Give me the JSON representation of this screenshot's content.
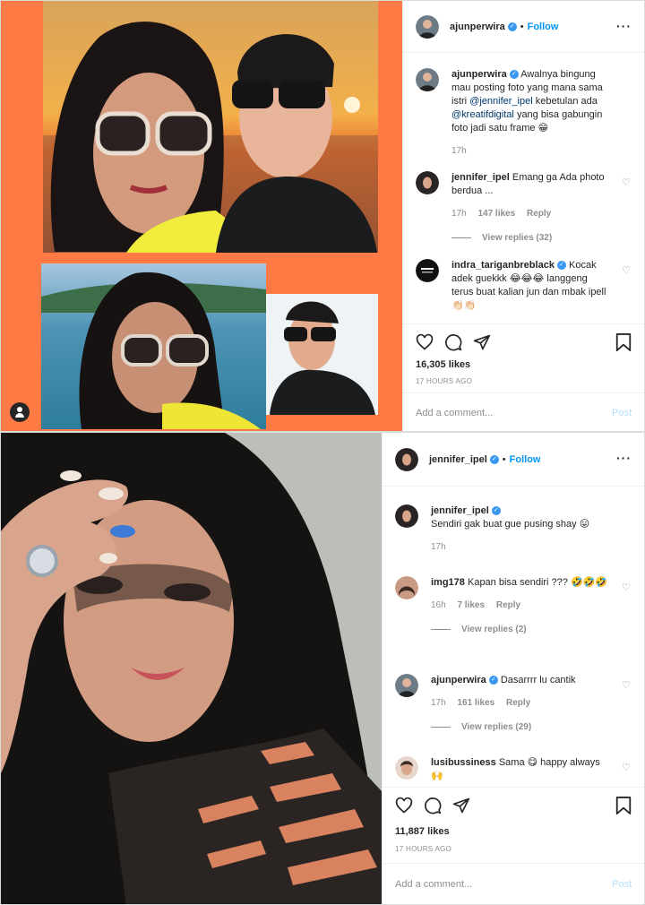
{
  "post1": {
    "header": {
      "username": "ajunperwira",
      "follow": "Follow",
      "separator": "•"
    },
    "caption": {
      "username": "ajunperwira",
      "text_1": "Awalnya bingung mau posting foto yang mana sama istri",
      "mention_1": "@jennifer_ipel",
      "text_2": "kebetulan ada",
      "mention_2": "@kreatifdigital",
      "text_3": "yang bisa gabungin foto jadi satu frame 😁",
      "time": "17h"
    },
    "comments": [
      {
        "username": "jennifer_ipel",
        "text": "Emang ga Ada photo berdua ...",
        "time": "17h",
        "likes": "147 likes",
        "reply": "Reply",
        "view_replies": "View replies (32)"
      },
      {
        "username": "indra_tariganbreblack",
        "text": "Kocak adek guekkk 😂😂😂 langgeng terus buat kalian jun dan mbak ipell👏🏻👏🏻"
      }
    ],
    "likes": "16,305 likes",
    "timestamp": "17 HOURS AGO",
    "add_comment_placeholder": "Add a comment...",
    "post_button": "Post",
    "colors": {
      "frame_orange": "#ff7a45"
    }
  },
  "post2": {
    "header": {
      "username": "jennifer_ipel",
      "follow": "Follow",
      "separator": "•"
    },
    "caption": {
      "username": "jennifer_ipel",
      "text": "Sendiri gak buat gue pusing shay 😛",
      "time": "17h"
    },
    "comments": [
      {
        "username": "img178",
        "text": "Kapan bisa sendiri ??? 🤣🤣🤣",
        "time": "16h",
        "likes": "7 likes",
        "reply": "Reply",
        "view_replies": "View replies (2)"
      },
      {
        "username": "ajunperwira",
        "text": "Dasarrrr lu cantik",
        "time": "17h",
        "likes": "161 likes",
        "reply": "Reply",
        "view_replies": "View replies (29)"
      },
      {
        "username": "lusibussiness",
        "text": "Sama 😋 happy always 🙌"
      }
    ],
    "likes": "11,887 likes",
    "timestamp": "17 HOURS AGO",
    "add_comment_placeholder": "Add a comment...",
    "post_button": "Post"
  },
  "icons": [
    "heart-icon",
    "comment-icon",
    "share-icon",
    "bookmark-icon",
    "more-icon",
    "verified-icon",
    "user-tag-icon"
  ],
  "colors": {
    "link_blue": "#0095f6",
    "mention_blue": "#00376b",
    "muted": "#8e8e8e",
    "border": "#dbdbdb"
  }
}
